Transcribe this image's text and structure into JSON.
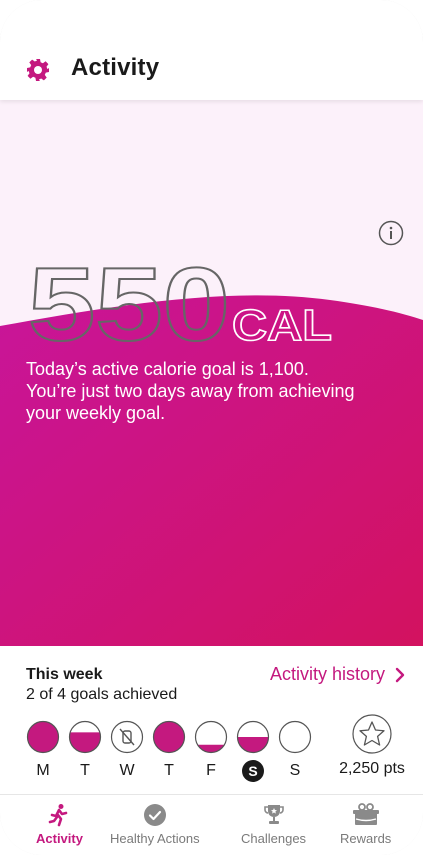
{
  "header": {
    "title": "Activity",
    "icon": "gear-icon"
  },
  "hero": {
    "calories_value": "550",
    "calories_unit": "CAL",
    "goal_lines": [
      "Today’s active calorie goal is 1,100.",
      "You’re just two days away from achieving",
      "your weekly goal."
    ],
    "colors": {
      "accent": "#c4197f",
      "gradient_start": "#c8159a",
      "gradient_end": "#d3125f",
      "background": "#fcf1fa"
    }
  },
  "week": {
    "label": "This week",
    "summary": "2 of 4 goals achieved",
    "history_label": "Activity history",
    "days": [
      {
        "letter": "M",
        "fill": 1.0,
        "selected": false,
        "no_watch": false
      },
      {
        "letter": "T",
        "fill": 0.65,
        "selected": false,
        "no_watch": false
      },
      {
        "letter": "W",
        "fill": 0,
        "selected": false,
        "no_watch": true
      },
      {
        "letter": "T",
        "fill": 1.0,
        "selected": false,
        "no_watch": false
      },
      {
        "letter": "F",
        "fill": 0.25,
        "selected": false,
        "no_watch": false
      },
      {
        "letter": "S",
        "fill": 0.5,
        "selected": true,
        "no_watch": false
      },
      {
        "letter": "S",
        "fill": 0,
        "selected": false,
        "no_watch": false
      }
    ],
    "points": "2,250 pts"
  },
  "tabs": [
    {
      "label": "Activity",
      "icon": "running-icon",
      "active": true
    },
    {
      "label": "Healthy Actions",
      "icon": "check-circle-icon",
      "active": false
    },
    {
      "label": "Challenges",
      "icon": "trophy-icon",
      "active": false
    },
    {
      "label": "Rewards",
      "icon": "gift-icon",
      "active": false
    }
  ]
}
